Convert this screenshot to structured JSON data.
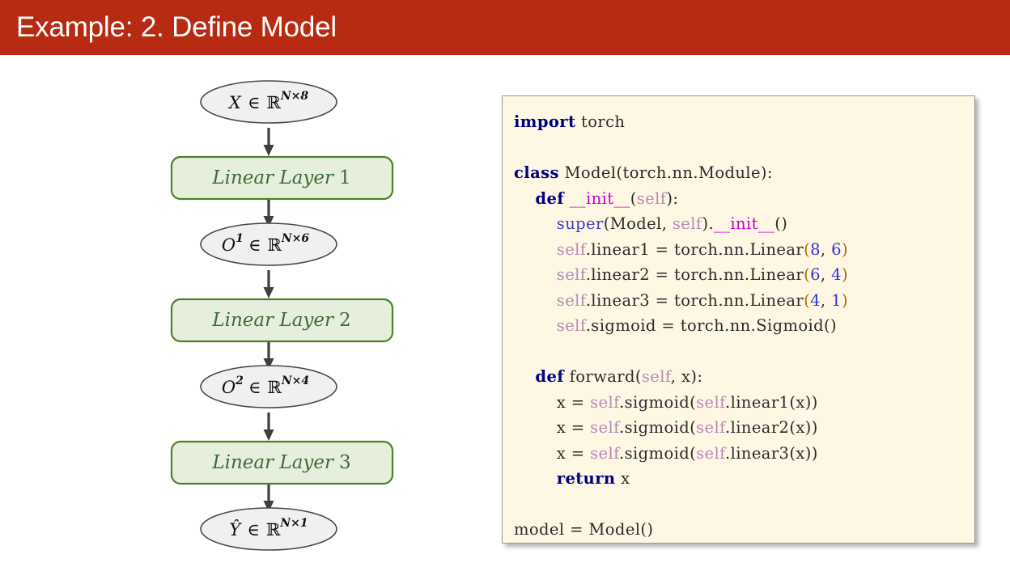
{
  "title_bar": {
    "text": "Example: 2. Define Model",
    "background_color": "#b72b12",
    "text_color": "#ffffff"
  },
  "flowchart": {
    "colors": {
      "ellipse_fill": "#f0f0f0",
      "ellipse_stroke": "#474747",
      "box_fill": "#e5efdb",
      "box_stroke": "#4f7f28",
      "box_text": "#3d6b3a",
      "arrow": "#3f3f3f"
    },
    "nodes": [
      {
        "kind": "ellipse",
        "id": "input-tensor",
        "symbol": "X",
        "sup": "",
        "rel": "∈",
        "space": "ℝ",
        "dims": "N×8",
        "text": "X ∈ ℝ^{N×8}"
      },
      {
        "kind": "box",
        "id": "linear-layer-1",
        "name": "Linear Layer",
        "index": "1",
        "text": "Linear Layer 1"
      },
      {
        "kind": "ellipse",
        "id": "output-1",
        "symbol": "O",
        "sup": "1",
        "rel": "∈",
        "space": "ℝ",
        "dims": "N×6",
        "text": "O¹ ∈ ℝ^{N×6}"
      },
      {
        "kind": "box",
        "id": "linear-layer-2",
        "name": "Linear Layer",
        "index": "2",
        "text": "Linear Layer 2"
      },
      {
        "kind": "ellipse",
        "id": "output-2",
        "symbol": "O",
        "sup": "2",
        "rel": "∈",
        "space": "ℝ",
        "dims": "N×4",
        "text": "O² ∈ ℝ^{N×4}"
      },
      {
        "kind": "box",
        "id": "linear-layer-3",
        "name": "Linear Layer",
        "index": "3",
        "text": "Linear Layer 3"
      },
      {
        "kind": "ellipse",
        "id": "prediction",
        "symbol": "Ŷ",
        "sup": "",
        "rel": "∈",
        "space": "ℝ",
        "dims": "N×1",
        "text": "Ŷ ∈ ℝ^{N×1}"
      }
    ]
  },
  "code_panel": {
    "background_color": "#fdf7e4",
    "border_color": "#9a9a9a",
    "language": "python",
    "syntax_colors": {
      "keyword": "#00007f",
      "dunder": "#cc00cc",
      "self": "#b888b8",
      "builtin": "#4040c0",
      "number": "#3434cf",
      "paren": "#b36b00",
      "plain": "#2b2b2b"
    },
    "lines": [
      [
        {
          "t": "import",
          "c": "kw"
        },
        {
          "t": " torch",
          "c": "pln"
        }
      ],
      [],
      [
        {
          "t": "class",
          "c": "kw"
        },
        {
          "t": " Model",
          "c": "pln"
        },
        {
          "t": "(",
          "c": "pln"
        },
        {
          "t": "torch.nn.Module",
          "c": "pln"
        },
        {
          "t": "):",
          "c": "pln"
        }
      ],
      [
        {
          "t": "    ",
          "c": "pln"
        },
        {
          "t": "def",
          "c": "kw"
        },
        {
          "t": " ",
          "c": "pln"
        },
        {
          "t": "__init__",
          "c": "dund"
        },
        {
          "t": "(",
          "c": "pln"
        },
        {
          "t": "self",
          "c": "slf"
        },
        {
          "t": "):",
          "c": "pln"
        }
      ],
      [
        {
          "t": "        ",
          "c": "pln"
        },
        {
          "t": "super",
          "c": "sup"
        },
        {
          "t": "(Model, ",
          "c": "pln"
        },
        {
          "t": "self",
          "c": "slf"
        },
        {
          "t": ").",
          "c": "pln"
        },
        {
          "t": "__init__",
          "c": "dund"
        },
        {
          "t": "()",
          "c": "pln"
        }
      ],
      [
        {
          "t": "        ",
          "c": "pln"
        },
        {
          "t": "self",
          "c": "slf"
        },
        {
          "t": ".linear1 = torch.nn.Linear",
          "c": "pln"
        },
        {
          "t": "(",
          "c": "par"
        },
        {
          "t": "8",
          "c": "num"
        },
        {
          "t": ", ",
          "c": "pln"
        },
        {
          "t": "6",
          "c": "num"
        },
        {
          "t": ")",
          "c": "par"
        }
      ],
      [
        {
          "t": "        ",
          "c": "pln"
        },
        {
          "t": "self",
          "c": "slf"
        },
        {
          "t": ".linear2 = torch.nn.Linear",
          "c": "pln"
        },
        {
          "t": "(",
          "c": "par"
        },
        {
          "t": "6",
          "c": "num"
        },
        {
          "t": ", ",
          "c": "pln"
        },
        {
          "t": "4",
          "c": "num"
        },
        {
          "t": ")",
          "c": "par"
        }
      ],
      [
        {
          "t": "        ",
          "c": "pln"
        },
        {
          "t": "self",
          "c": "slf"
        },
        {
          "t": ".linear3 = torch.nn.Linear",
          "c": "pln"
        },
        {
          "t": "(",
          "c": "par"
        },
        {
          "t": "4",
          "c": "num"
        },
        {
          "t": ", ",
          "c": "pln"
        },
        {
          "t": "1",
          "c": "num"
        },
        {
          "t": ")",
          "c": "par"
        }
      ],
      [
        {
          "t": "        ",
          "c": "pln"
        },
        {
          "t": "self",
          "c": "slf"
        },
        {
          "t": ".sigmoid = torch.nn.Sigmoid()",
          "c": "pln"
        }
      ],
      [],
      [
        {
          "t": "    ",
          "c": "pln"
        },
        {
          "t": "def",
          "c": "kw"
        },
        {
          "t": " forward(",
          "c": "pln"
        },
        {
          "t": "self",
          "c": "slf"
        },
        {
          "t": ", x):",
          "c": "pln"
        }
      ],
      [
        {
          "t": "        x = ",
          "c": "pln"
        },
        {
          "t": "self",
          "c": "slf"
        },
        {
          "t": ".sigmoid(",
          "c": "pln"
        },
        {
          "t": "self",
          "c": "slf"
        },
        {
          "t": ".linear1(x))",
          "c": "pln"
        }
      ],
      [
        {
          "t": "        x = ",
          "c": "pln"
        },
        {
          "t": "self",
          "c": "slf"
        },
        {
          "t": ".sigmoid(",
          "c": "pln"
        },
        {
          "t": "self",
          "c": "slf"
        },
        {
          "t": ".linear2(x))",
          "c": "pln"
        }
      ],
      [
        {
          "t": "        x = ",
          "c": "pln"
        },
        {
          "t": "self",
          "c": "slf"
        },
        {
          "t": ".sigmoid(",
          "c": "pln"
        },
        {
          "t": "self",
          "c": "slf"
        },
        {
          "t": ".linear3(x))",
          "c": "pln"
        }
      ],
      [
        {
          "t": "        ",
          "c": "pln"
        },
        {
          "t": "return",
          "c": "kw"
        },
        {
          "t": " x",
          "c": "pln"
        }
      ],
      [],
      [
        {
          "t": "model = Model()",
          "c": "pln"
        }
      ]
    ]
  }
}
